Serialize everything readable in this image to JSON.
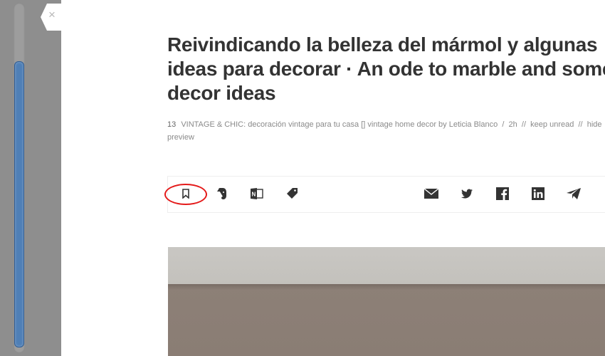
{
  "article": {
    "title": "Reivindicando la belleza del mármol y algunas ideas para decorar · An ode to marble and some decor ideas",
    "meta": {
      "count": "13",
      "source": "VINTAGE & CHIC: decoración vintage para tu casa [] vintage home decor by Leticia Blanco",
      "sep1": "/",
      "age": "2h",
      "sep2": "//",
      "keep_unread": "keep unread",
      "sep3": "//",
      "hide": "hide",
      "sep4": "//",
      "preview": "preview"
    }
  },
  "close": {
    "glyph": "×"
  },
  "toolbar": {
    "highlight_color": "#e41a1a",
    "icons": [
      "bookmark-icon",
      "evernote-icon",
      "onenote-icon",
      "tag-icon",
      "mail-icon",
      "twitter-icon",
      "facebook-icon",
      "linkedin-icon",
      "send-icon"
    ]
  },
  "colors": {
    "title": "#333333",
    "meta": "#8a8a8a",
    "scroll_thumb": "#4f7fb6"
  }
}
